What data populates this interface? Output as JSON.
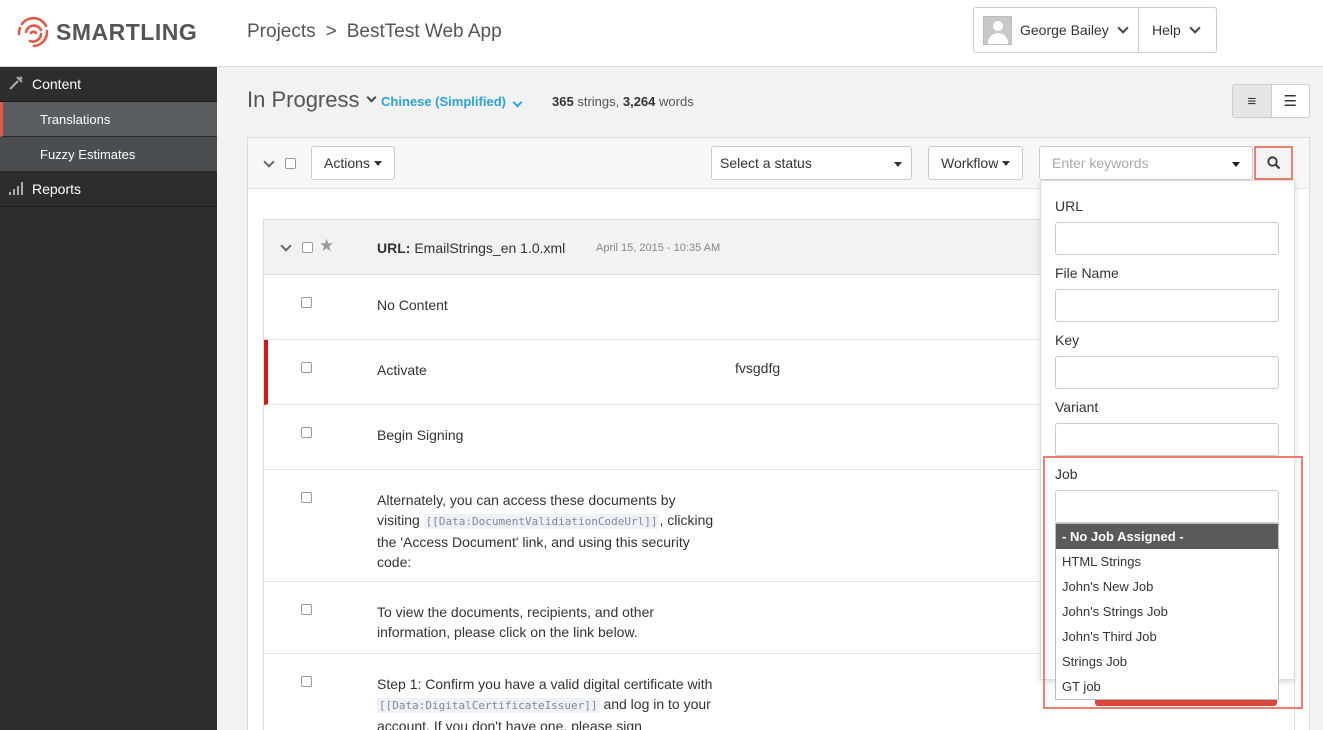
{
  "brand": {
    "name": "SMARTLING",
    "accent": "#e05a4b"
  },
  "breadcrumb": {
    "root": "Projects",
    "separator": ">",
    "current": "BestTest Web App"
  },
  "user_menu": {
    "name": "George Bailey",
    "help": "Help"
  },
  "sidebar": {
    "content": "Content",
    "translations": "Translations",
    "fuzzy": "Fuzzy Estimates",
    "reports": "Reports"
  },
  "header": {
    "status": "In Progress",
    "language": "Chinese (Simplified)",
    "strings_count": "365",
    "strings_label": "strings,",
    "words_count": "3,264",
    "words_label": "words"
  },
  "toolbar": {
    "actions": "Actions",
    "status_select": "Select a status",
    "workflow": "Workflow",
    "keyword_placeholder": "Enter keywords"
  },
  "file_group": {
    "url_label": "URL:",
    "url": "EmailStrings_en 1.0.xml",
    "date": "April 15, 2015 - 10:35 AM"
  },
  "rows": {
    "r1": "No Content",
    "r2": "Activate",
    "r2_target": "fvsgdfg",
    "r3": "Begin Signing",
    "r4_a": "Alternately, you can access these documents by visiting",
    "r4_ph": "[[Data:DocumentValidiationCodeUrl]]",
    "r4_b": ", clicking the 'Access Document' link, and using this security code:",
    "r5": "To view the documents, recipients, and other information, please click on the link below.",
    "r6_a": "Step 1: Confirm you have a valid digital certificate with",
    "r6_ph": "[[Data:DigitalCertificateIssuer]]",
    "r6_b": "and log in to your account. If you don't have one, please sign"
  },
  "filter": {
    "url": "URL",
    "file_name": "File Name",
    "key": "Key",
    "variant": "Variant",
    "job": "Job",
    "job_options": [
      "- No Job Assigned -",
      "HTML Strings",
      "John's New Job",
      "John's Strings Job",
      "John's Third Job",
      "Strings Job",
      "GT job"
    ],
    "selected_job": "- No Job Assigned -"
  }
}
